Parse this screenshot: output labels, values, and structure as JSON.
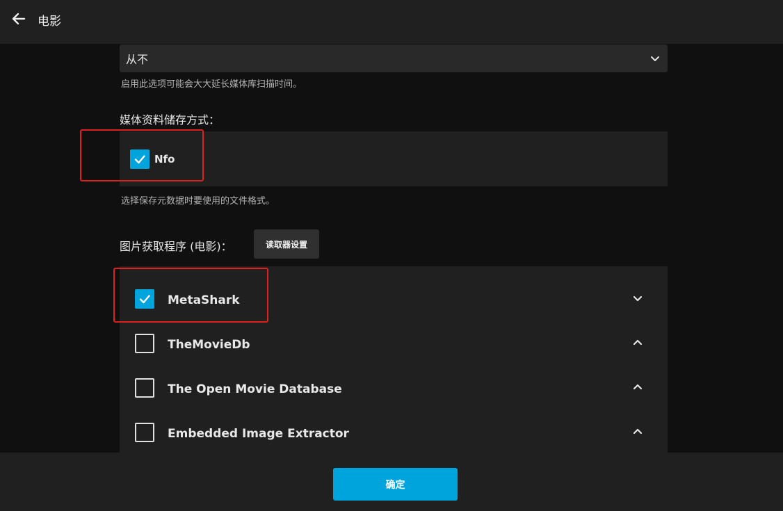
{
  "header": {
    "title": "电影",
    "back_icon": "arrow-left-icon"
  },
  "refresh": {
    "selected": "从不",
    "help": "启用此选项可能会大大延长媒体库扫描时间。"
  },
  "metadata_savers": {
    "label": "媒体资料储存方式：",
    "items": [
      {
        "label": "Nfo",
        "checked": true
      }
    ],
    "help": "选择保存元数据时要使用的文件格式。"
  },
  "image_fetchers": {
    "label": "图片获取程序 (电影)：",
    "settings_button": "读取器设置",
    "items": [
      {
        "label": "MetaShark",
        "checked": true,
        "chevron": "chevron-down-icon"
      },
      {
        "label": "TheMovieDb",
        "checked": false,
        "chevron": "chevron-up-icon"
      },
      {
        "label": "The Open Movie Database",
        "checked": false,
        "chevron": "chevron-up-icon"
      },
      {
        "label": "Embedded Image Extractor",
        "checked": false,
        "chevron": "chevron-up-icon"
      }
    ]
  },
  "footer": {
    "ok_label": "确定"
  },
  "colors": {
    "accent": "#00a4dc",
    "highlight": "#e0201c",
    "background": "#101010",
    "surface": "#202020"
  }
}
